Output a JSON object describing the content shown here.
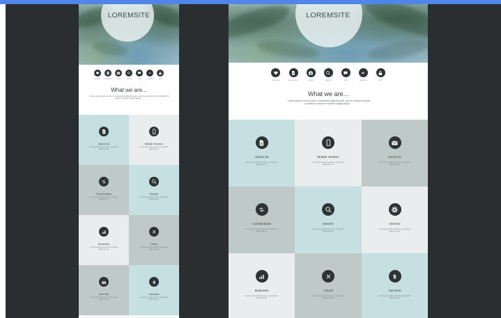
{
  "site_title": "LOREMSITE",
  "intro": {
    "headline": "What we are...",
    "subline": "\" Lorem ipsum dolor sit amet, consectetur adipiscing elit, sed do eiusmod tempor incididunt ut labore et dolore magna aliqua. \""
  },
  "colors": {
    "stage": "#2a2e30",
    "top_bar": "#4f86e8",
    "tile_blue": "#c6dfe1",
    "tile_light": "#eaedee",
    "tile_gray": "#bfc9c8",
    "icon_fill": "#2e3335"
  },
  "nav_icons": [
    {
      "icon": "heart-icon",
      "caption": "favorite"
    },
    {
      "icon": "document-icon",
      "caption": "document"
    },
    {
      "icon": "camera-icon",
      "caption": "photo"
    },
    {
      "icon": "search-icon",
      "caption": "search"
    },
    {
      "icon": "chat-icon",
      "caption": "chat"
    },
    {
      "icon": "link-icon",
      "caption": "website"
    },
    {
      "icon": "lock-icon",
      "caption": "lock"
    }
  ],
  "services": [
    {
      "label": "About Us",
      "icon": "document-icon",
      "text": "Lorem ipsum dolor sit amet, consectetur adipiscing elit."
    },
    {
      "label": "Mobile Version",
      "icon": "mobile-icon",
      "text": "Lorem ipsum dolor sit amet, consectetur adipiscing elit."
    },
    {
      "label": "Send Us",
      "icon": "mail-icon",
      "text": "Lorem ipsum dolor sit amet, consectetur adipiscing elit."
    },
    {
      "label": "Connections",
      "icon": "connections-icon",
      "text": "Lorem ipsum dolor sit amet, consectetur adipiscing elit."
    },
    {
      "label": "Search",
      "icon": "search-icon",
      "text": "Lorem ipsum dolor sit amet, consectetur adipiscing elit."
    },
    {
      "label": "Service",
      "icon": "gear-icon",
      "text": "Lorem ipsum dolor sit amet, consectetur adipiscing elit."
    },
    {
      "label": "Business",
      "icon": "chart-icon",
      "text": "Lorem ipsum dolor sit amet, consectetur adipiscing elit."
    },
    {
      "label": "Travel",
      "icon": "compass-icon",
      "text": "Lorem ipsum dolor sit amet, consectetur adipiscing elit."
    },
    {
      "label": "Success",
      "icon": "dollar-icon",
      "text": "Lorem ipsum dolor sit amet, consectetur adipiscing elit."
    },
    {
      "label": "Hot Gift",
      "icon": "gift-icon",
      "text": "Lorem ipsum dolor sit amet, consectetur adipiscing elit."
    }
  ],
  "mobile_layout": {
    "tile_order": [
      0,
      1,
      3,
      4,
      6,
      7,
      9,
      8
    ],
    "tile_colors": [
      "blue",
      "light",
      "gray",
      "blue",
      "light",
      "gray",
      "gray",
      "blue"
    ]
  },
  "desktop_layout": {
    "tile_order": [
      0,
      1,
      2,
      3,
      4,
      5,
      6,
      7,
      8
    ],
    "tile_colors": [
      "blue",
      "light",
      "gray",
      "gray",
      "blue",
      "light",
      "light",
      "gray",
      "blue"
    ]
  }
}
